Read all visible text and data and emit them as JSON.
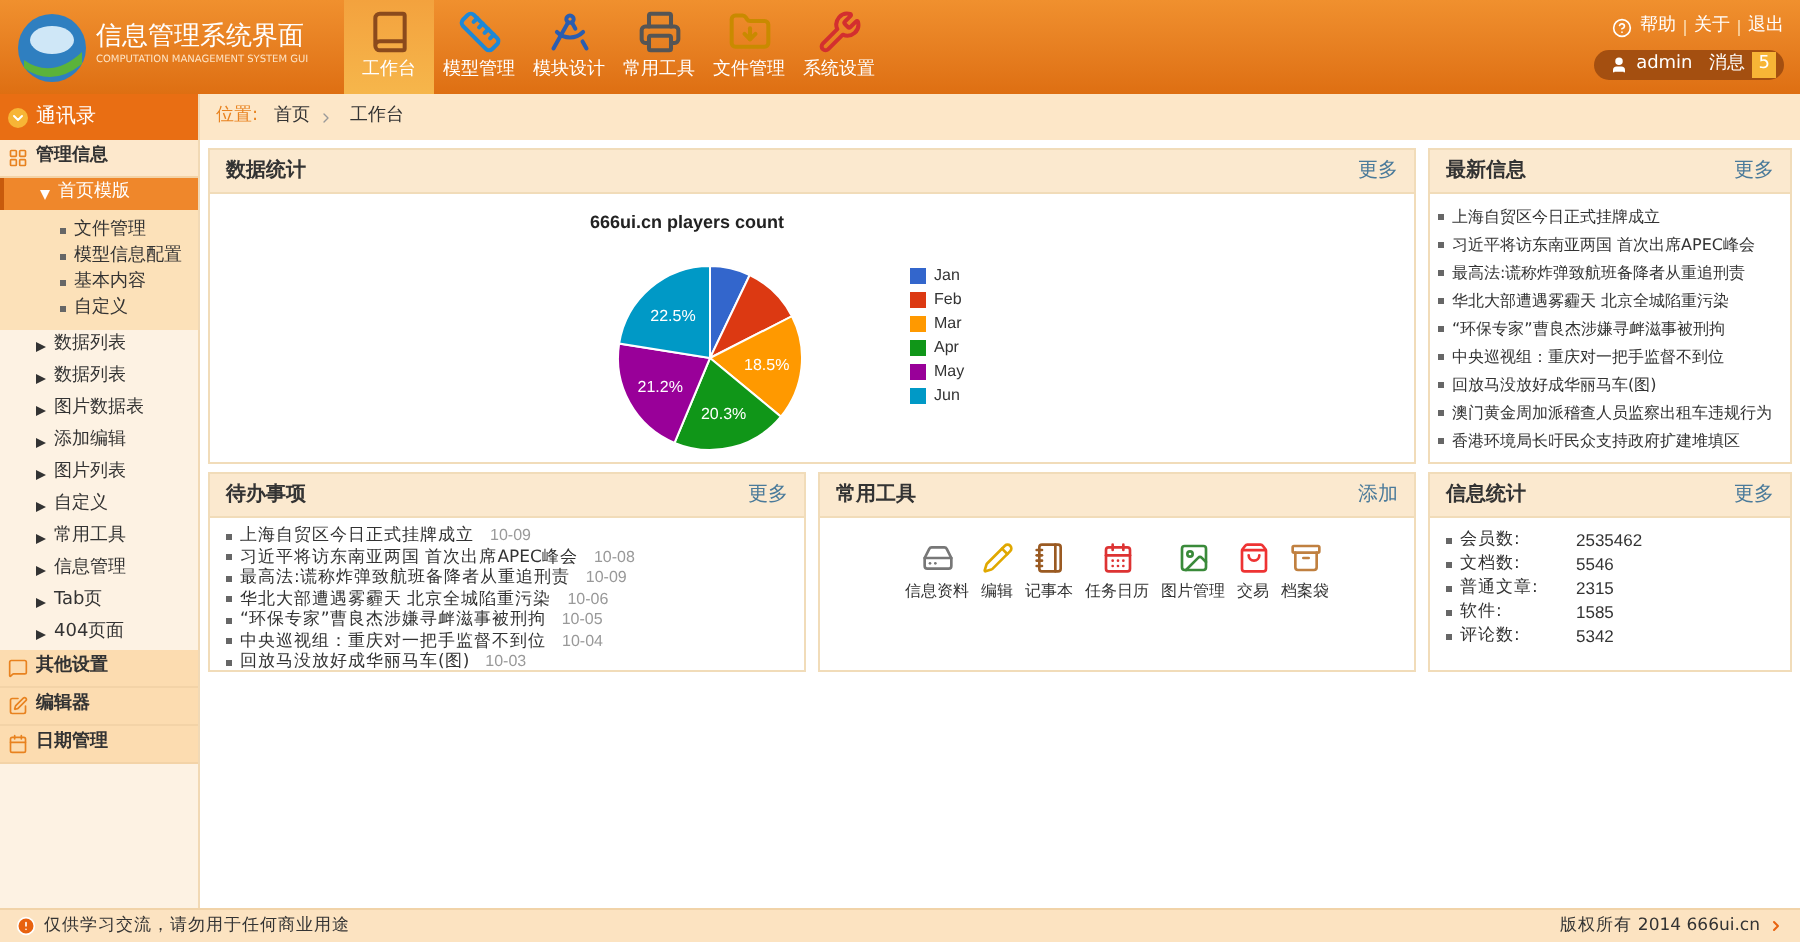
{
  "header": {
    "title": "信息管理系统界面",
    "subtitle": "COMPUTATION MANAGEMENT SYSTEM GUI",
    "nav": [
      {
        "label": "工作台",
        "selected": true
      },
      {
        "label": "模型管理",
        "selected": false
      },
      {
        "label": "模块设计",
        "selected": false
      },
      {
        "label": "常用工具",
        "selected": false
      },
      {
        "label": "文件管理",
        "selected": false
      },
      {
        "label": "系统设置",
        "selected": false
      }
    ],
    "links": [
      "帮助",
      "关于",
      "退出"
    ],
    "user": {
      "name": "admin",
      "messages_label": "消息",
      "message_count": "5"
    }
  },
  "sidebar": {
    "header": "通讯录",
    "sections": [
      {
        "label": "管理信息",
        "expanded": true,
        "items": [
          {
            "label": "首页模版",
            "selected": true,
            "expanded": true,
            "children": [
              "文件管理",
              "模型信息配置",
              "基本内容",
              "自定义"
            ]
          },
          {
            "label": "数据列表",
            "selected": false,
            "expanded": false
          },
          {
            "label": "数据列表",
            "selected": false,
            "expanded": false
          },
          {
            "label": "图片数据表",
            "selected": false,
            "expanded": false
          },
          {
            "label": "添加编辑",
            "selected": false,
            "expanded": false
          },
          {
            "label": "图片列表",
            "selected": false,
            "expanded": false
          },
          {
            "label": "自定义",
            "selected": false,
            "expanded": false
          },
          {
            "label": "常用工具",
            "selected": false,
            "expanded": false
          },
          {
            "label": "信息管理",
            "selected": false,
            "expanded": false
          },
          {
            "label": "Tab页",
            "selected": false,
            "expanded": false
          },
          {
            "label": "404页面",
            "selected": false,
            "expanded": false
          }
        ]
      },
      {
        "label": "其他设置",
        "expanded": false
      },
      {
        "label": "编辑器",
        "expanded": false
      },
      {
        "label": "日期管理",
        "expanded": false
      }
    ]
  },
  "breadcrumb": {
    "label": "位置:",
    "path": [
      "首页",
      "工作台"
    ]
  },
  "data_panel": {
    "title": "数据统计",
    "more": "更多",
    "chart_data": {
      "type": "pie",
      "title": "666ui.cn players count",
      "categories": [
        "Jan",
        "Feb",
        "Mar",
        "Apr",
        "May",
        "Jun"
      ],
      "values": [
        7.1,
        10.4,
        18.5,
        20.3,
        21.2,
        22.5
      ],
      "colors": [
        "#3366cc",
        "#dc3912",
        "#ff9900",
        "#109618",
        "#990099",
        "#0099c6"
      ],
      "value_labels": [
        null,
        null,
        "18.5%",
        "20.3%",
        "21.2%",
        "22.5%"
      ],
      "legend": "right"
    }
  },
  "news_panel": {
    "title": "最新信息",
    "more": "更多",
    "items": [
      "上海自贸区今日正式挂牌成立",
      "习近平将访东南亚两国 首次出席APEC峰会",
      "最高法:谎称炸弹致航班备降者从重追刑责",
      "华北大部遭遇雾霾天 北京全城陷重污染",
      "“环保专家”曹良杰涉嫌寻衅滋事被刑拘",
      "中央巡视组：重庆对一把手监督不到位",
      "回放马没放好成华丽马车(图)",
      "澳门黄金周加派稽查人员监察出租车违规行为",
      "香港环境局长吁民众支持政府扩建堆填区"
    ]
  },
  "todo_panel": {
    "title": "待办事项",
    "more": "更多",
    "items": [
      {
        "text": "上海自贸区今日正式挂牌成立",
        "date": "10-09"
      },
      {
        "text": "习近平将访东南亚两国 首次出席APEC峰会",
        "date": "10-08"
      },
      {
        "text": "最高法:谎称炸弹致航班备降者从重追刑责",
        "date": "10-09"
      },
      {
        "text": "华北大部遭遇雾霾天 北京全城陷重污染",
        "date": "10-06"
      },
      {
        "text": "“环保专家”曹良杰涉嫌寻衅滋事被刑拘",
        "date": "10-05"
      },
      {
        "text": "中央巡视组：重庆对一把手监督不到位",
        "date": "10-04"
      },
      {
        "text": "回放马没放好成华丽马车(图)",
        "date": "10-03"
      }
    ]
  },
  "tools_panel": {
    "title": "常用工具",
    "add": "添加",
    "tools": [
      "信息资料",
      "编辑",
      "记事本",
      "任务日历",
      "图片管理",
      "交易",
      "档案袋"
    ]
  },
  "stats_panel": {
    "title": "信息统计",
    "more": "更多",
    "items": [
      {
        "label": "会员数:",
        "value": "2535462"
      },
      {
        "label": "文档数:",
        "value": "5546"
      },
      {
        "label": "普通文章:",
        "value": "2315"
      },
      {
        "label": "软件:",
        "value": "1585"
      },
      {
        "label": "评论数:",
        "value": "5342"
      }
    ]
  },
  "footer": {
    "notice": "仅供学习交流，请勿用于任何商业用途",
    "copyright": "版权所有 2014 666ui.cn"
  }
}
